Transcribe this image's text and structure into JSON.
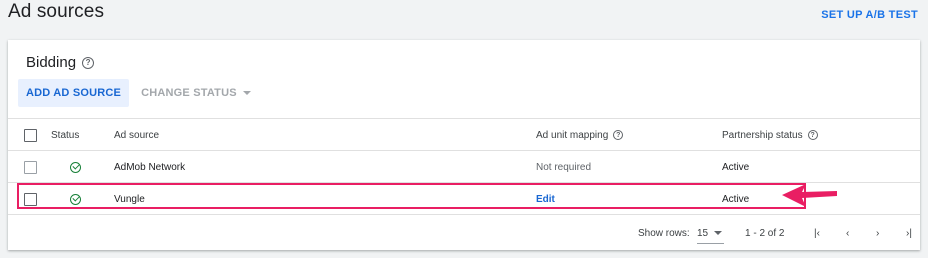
{
  "page": {
    "title": "Ad sources",
    "ab_test_link": "SET UP A/B TEST"
  },
  "bidding": {
    "title": "Bidding",
    "add_button": "ADD AD SOURCE",
    "change_status_button": "CHANGE STATUS"
  },
  "table": {
    "headers": {
      "status": "Status",
      "ad_source": "Ad source",
      "ad_unit_mapping": "Ad unit mapping",
      "partnership_status": "Partnership status"
    },
    "rows": [
      {
        "status_icon": "check-circle-icon",
        "ad_source": "AdMob Network",
        "mapping": "Not required",
        "partnership": "Active"
      },
      {
        "status_icon": "check-circle-icon",
        "ad_source": "Vungle",
        "mapping": "Edit",
        "partnership": "Active"
      }
    ]
  },
  "pagination": {
    "show_rows_label": "Show rows:",
    "rows_value": "15",
    "range": "1 - 2 of 2"
  },
  "colors": {
    "accent": "#1a73e8",
    "annotation": "#e91e63",
    "status_ok": "#188038"
  }
}
